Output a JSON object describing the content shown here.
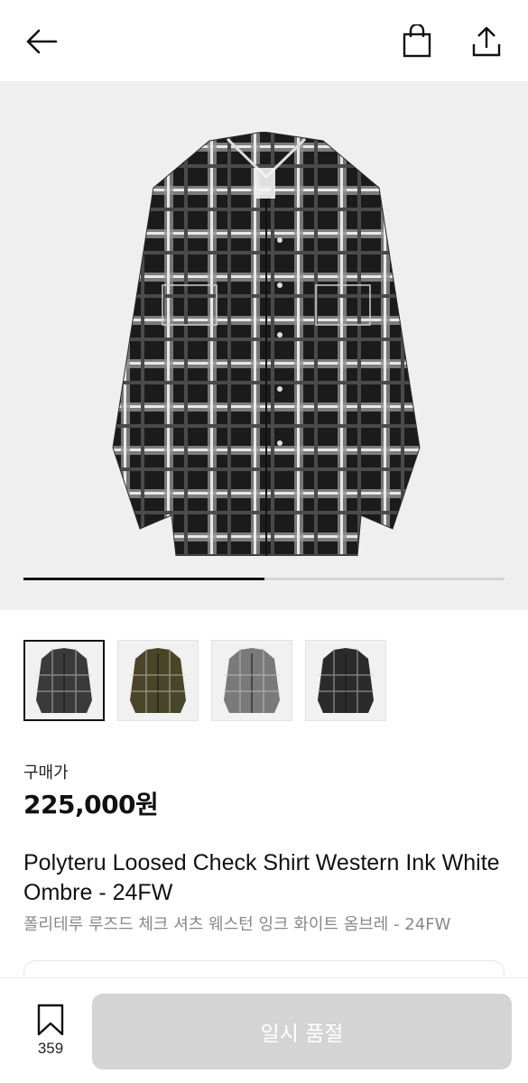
{
  "header": {
    "back_icon": "arrow-left-icon",
    "bag_icon": "shopping-bag-icon",
    "share_icon": "share-icon"
  },
  "gallery": {
    "progress_fraction": 0.5,
    "thumbnail_colors": [
      "#3a3a3a",
      "#4a4528",
      "#7a7a7a",
      "#2b2b2b"
    ],
    "active_thumbnail_index": 0
  },
  "product": {
    "price_label": "구매가",
    "price": "225,000원",
    "name_en": "Polyteru Loosed Check Shirt Western Ink White Ombre - 24FW",
    "name_ko": "폴리테루 루즈드 체크 셔츠 웨스턴 잉크 화이트 옴브레 - 24FW"
  },
  "bottom_bar": {
    "bookmark_icon": "bookmark-icon",
    "bookmark_count": "359",
    "cta_label": "일시 품절"
  },
  "colors": {
    "background": "#ffffff",
    "hero_bg": "#efefef",
    "cta_disabled": "#d4d4d4",
    "text_secondary": "#888888"
  }
}
